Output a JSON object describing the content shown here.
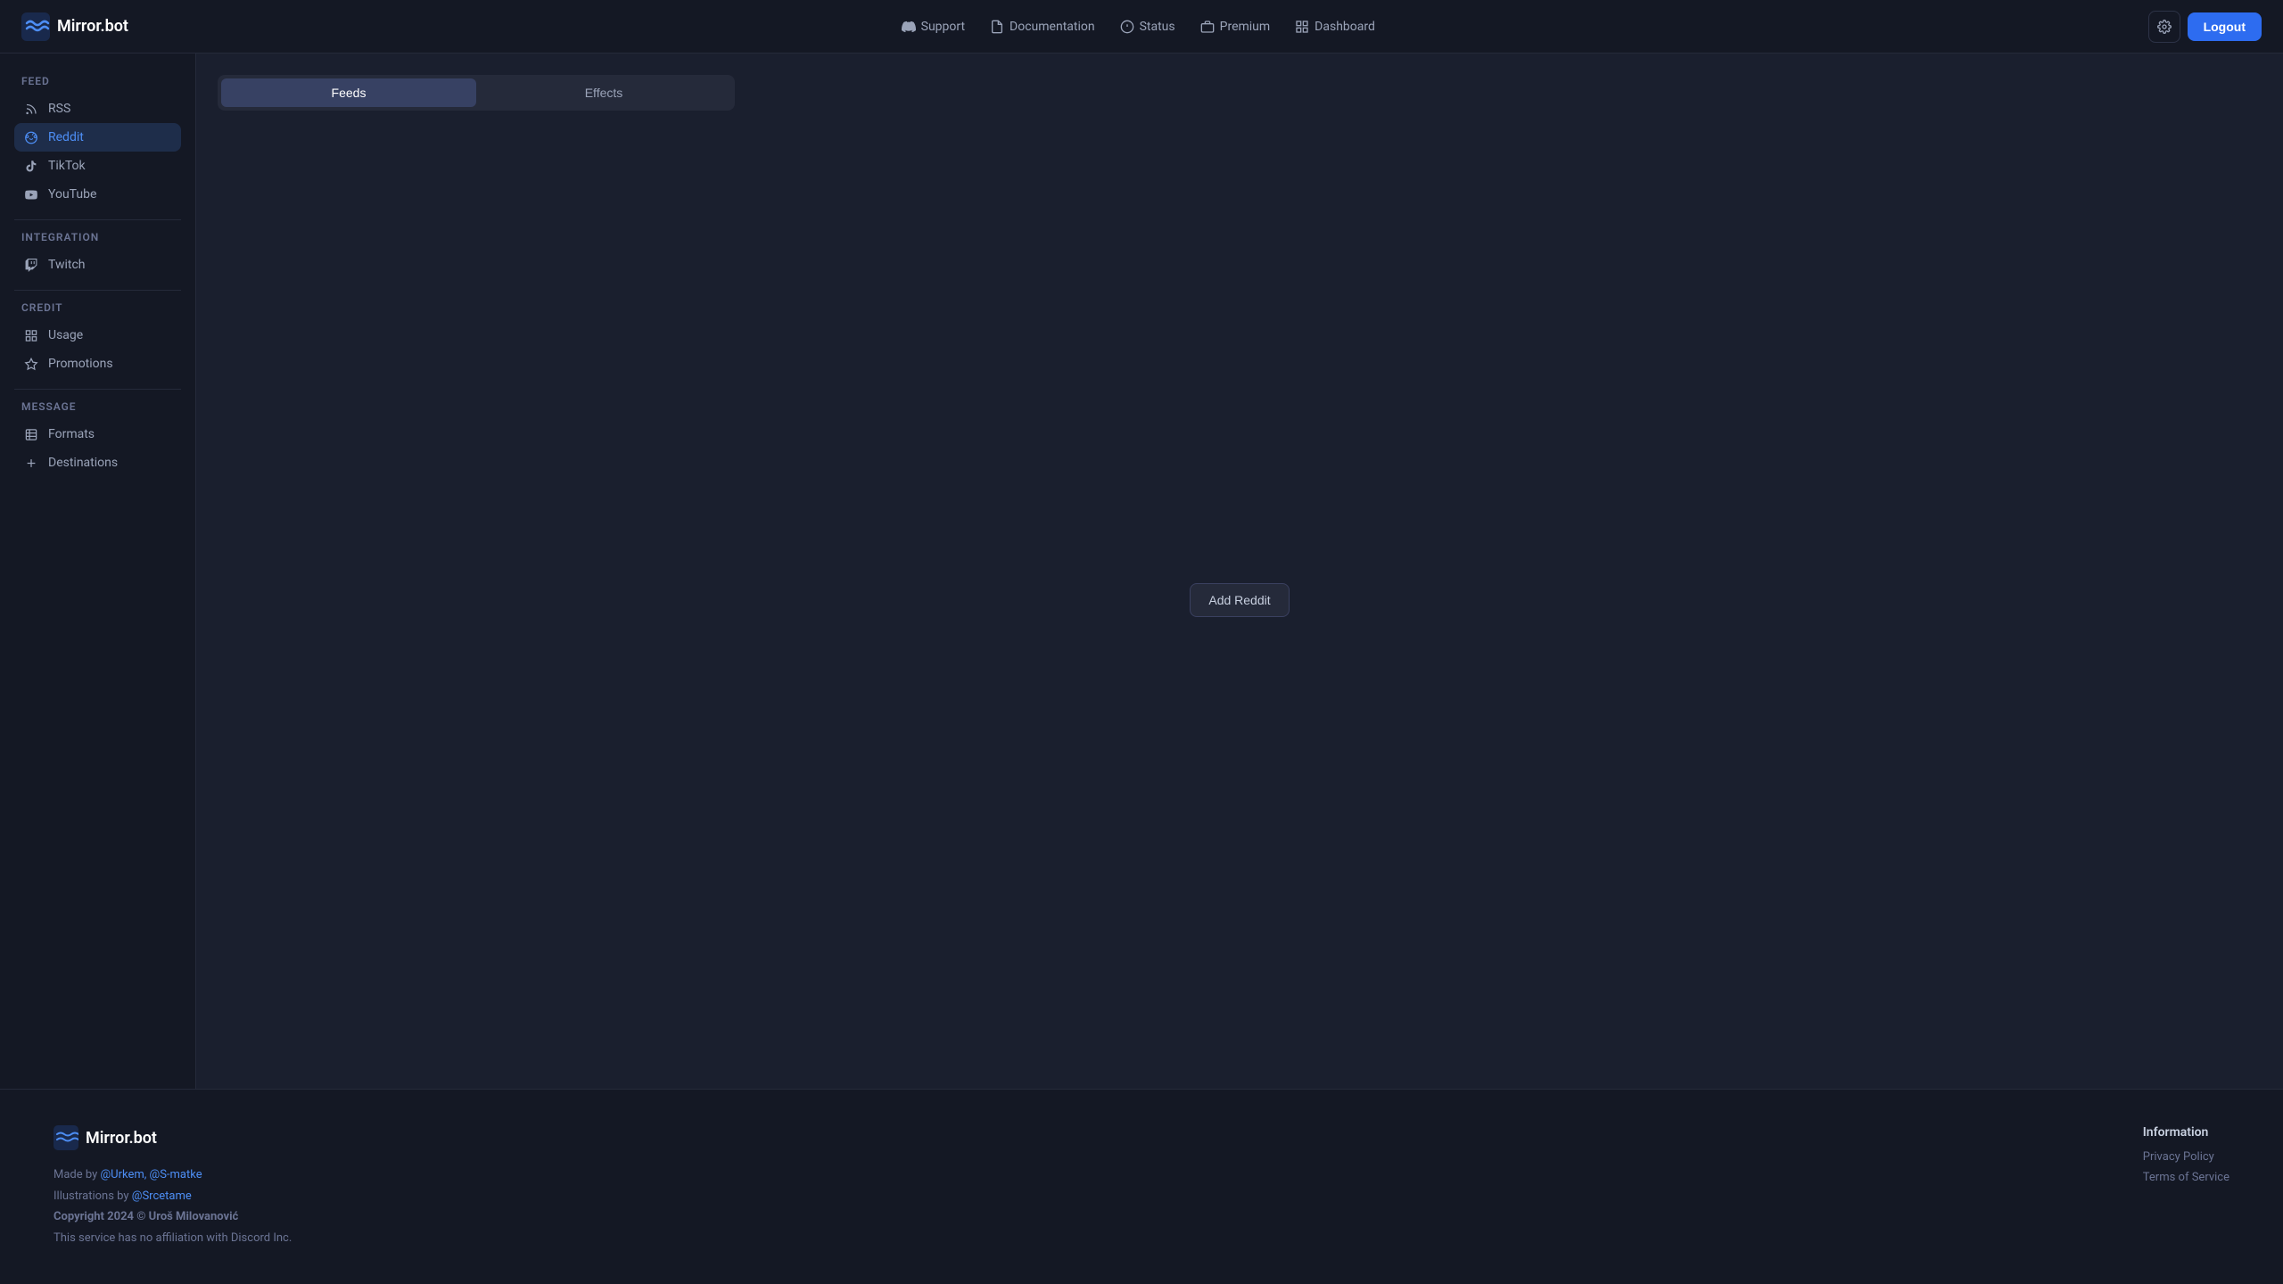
{
  "header": {
    "logo_text": "Mirror.bot",
    "nav_items": [
      {
        "id": "support",
        "label": "Support",
        "icon": "discord"
      },
      {
        "id": "documentation",
        "label": "Documentation",
        "icon": "file"
      },
      {
        "id": "status",
        "label": "Status",
        "icon": "circle"
      },
      {
        "id": "premium",
        "label": "Premium",
        "icon": "box"
      },
      {
        "id": "dashboard",
        "label": "Dashboard",
        "icon": "grid"
      }
    ],
    "logout_label": "Logout"
  },
  "sidebar": {
    "sections": [
      {
        "label": "Feed",
        "items": [
          {
            "id": "rss",
            "label": "RSS",
            "icon": "rss"
          },
          {
            "id": "reddit",
            "label": "Reddit",
            "icon": "reddit",
            "active": true
          },
          {
            "id": "tiktok",
            "label": "TikTok",
            "icon": "tiktok"
          },
          {
            "id": "youtube",
            "label": "YouTube",
            "icon": "youtube"
          }
        ]
      },
      {
        "label": "Integration",
        "items": [
          {
            "id": "twitch",
            "label": "Twitch",
            "icon": "twitch"
          }
        ]
      },
      {
        "label": "Credit",
        "items": [
          {
            "id": "usage",
            "label": "Usage",
            "icon": "usage"
          },
          {
            "id": "promotions",
            "label": "Promotions",
            "icon": "promotions"
          }
        ]
      },
      {
        "label": "Message",
        "items": [
          {
            "id": "formats",
            "label": "Formats",
            "icon": "formats"
          },
          {
            "id": "destinations",
            "label": "Destinations",
            "icon": "destinations"
          }
        ]
      }
    ]
  },
  "tabs": [
    {
      "id": "feeds",
      "label": "Feeds",
      "active": true
    },
    {
      "id": "effects",
      "label": "Effects",
      "active": false
    }
  ],
  "content": {
    "add_button_label": "Add Reddit"
  },
  "footer": {
    "logo_text": "Mirror.bot",
    "made_by_prefix": "Made by ",
    "made_by_authors": "@Urkem, @S-matke",
    "illustrations_prefix": "Illustrations by ",
    "illustrations_author": "@Srcetame",
    "copyright": "Copyright 2024 © Uroš Milovanović",
    "disclaimer": "This service has no affiliation with Discord Inc.",
    "info_section": {
      "title": "Information",
      "links": [
        {
          "id": "privacy",
          "label": "Privacy Policy"
        },
        {
          "id": "terms",
          "label": "Terms of Service"
        }
      ]
    }
  }
}
